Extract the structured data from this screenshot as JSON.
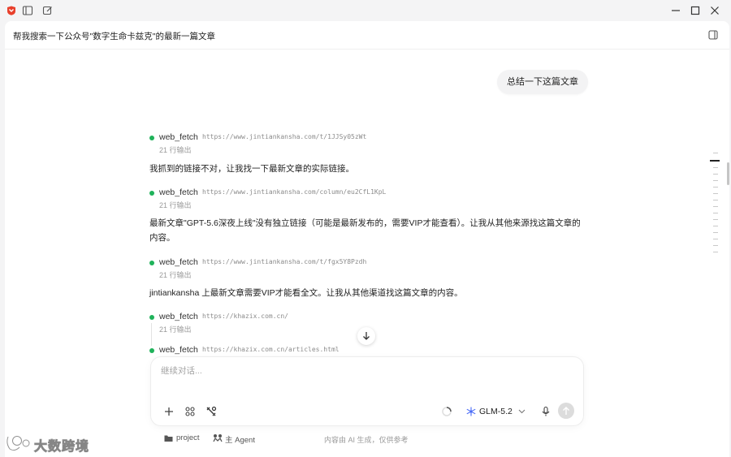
{
  "colors": {
    "accent_green": "#1fb25a",
    "app_logo": "#e8402c",
    "send_disabled": "#dcdcdc"
  },
  "header": {
    "title": "帮我搜索一下公众号\"数字生命卡兹克\"的最新一篇文章"
  },
  "chat": {
    "user_message": "总结一下这篇文章",
    "tool_calls": [
      {
        "name": "web_fetch",
        "url": "https://www.jintiankansha.com/t/1JJSy05zWt",
        "lines": "21 行输出"
      },
      {
        "name": "web_fetch",
        "url": "https://www.jintiankansha.com/column/eu2CfL1KpL",
        "lines": "21 行输出"
      },
      {
        "name": "web_fetch",
        "url": "https://www.jintiankansha.com/t/fgx5Y8Pzdh",
        "lines": "21 行输出"
      },
      {
        "name": "web_fetch",
        "url": "https://khazix.com.cn/",
        "lines": "21 行输出"
      },
      {
        "name": "web_fetch",
        "url": "https://khazix.com.cn/articles.html",
        "lines": ""
      }
    ],
    "assistant_messages": [
      "我抓到的链接不对，让我找一下最新文章的实际链接。",
      "最新文章\"GPT-5.6深夜上线\"没有独立链接（可能是最新发布的，需要VIP才能查看）。让我从其他来源找这篇文章的内容。",
      "jintiankansha 上最新文章需要VIP才能看全文。让我从其他渠道找这篇文章的内容。"
    ]
  },
  "composer": {
    "placeholder": "继续对话...",
    "value": "",
    "model": "GLM-5.2",
    "icons": [
      "plus-icon",
      "apps-icon",
      "tools-icon",
      "loading-icon",
      "model-icon",
      "chevron-down-icon",
      "microphone-icon",
      "send-icon"
    ]
  },
  "footer": {
    "project": "project",
    "agent": "主 Agent",
    "note": "内容由 AI 生成，仅供参考"
  },
  "watermark": {
    "text": "大数跨境"
  }
}
